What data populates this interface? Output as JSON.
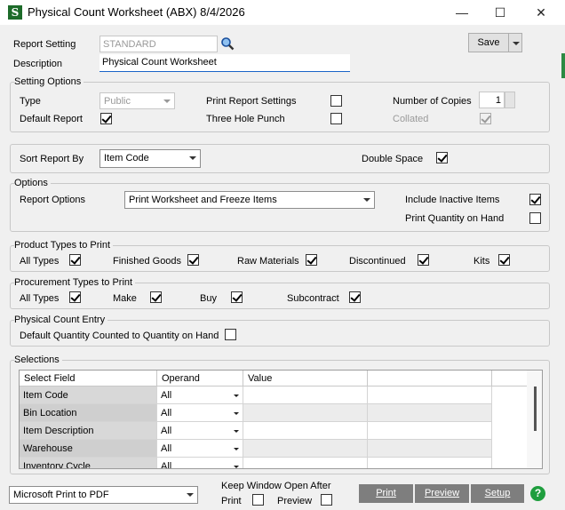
{
  "window": {
    "title": "Physical Count Worksheet (ABX) 8/4/2026",
    "minimize": "—",
    "maximize": "☐",
    "close": "✕",
    "app_icon": "S"
  },
  "header": {
    "report_setting_label": "Report Setting",
    "report_setting_value": "STANDARD",
    "description_label": "Description",
    "description_value": "Physical Count Worksheet",
    "save_label": "Save"
  },
  "setting_options": {
    "title": "Setting Options",
    "type_label": "Type",
    "type_value": "Public",
    "default_report_label": "Default Report",
    "default_report_checked": true,
    "print_report_settings_label": "Print Report Settings",
    "print_report_settings_checked": false,
    "three_hole_punch_label": "Three Hole Punch",
    "three_hole_punch_checked": false,
    "number_of_copies_label": "Number of Copies",
    "number_of_copies_value": "1",
    "collated_label": "Collated",
    "collated_checked": true
  },
  "sort": {
    "sort_report_by_label": "Sort Report By",
    "sort_report_by_value": "Item Code",
    "double_space_label": "Double Space",
    "double_space_checked": true
  },
  "options": {
    "title": "Options",
    "report_options_label": "Report Options",
    "report_options_value": "Print Worksheet and Freeze Items",
    "include_inactive_label": "Include Inactive Items",
    "include_inactive_checked": true,
    "print_qty_label": "Print Quantity on Hand",
    "print_qty_checked": false
  },
  "product_types": {
    "title": "Product Types to Print",
    "items": [
      {
        "label": "All Types",
        "checked": true
      },
      {
        "label": "Finished Goods",
        "checked": true
      },
      {
        "label": "Raw Materials",
        "checked": true
      },
      {
        "label": "Discontinued",
        "checked": true
      },
      {
        "label": "Kits",
        "checked": true
      }
    ]
  },
  "procurement_types": {
    "title": "Procurement Types to Print",
    "items": [
      {
        "label": "All Types",
        "checked": true
      },
      {
        "label": "Make",
        "checked": true
      },
      {
        "label": "Buy",
        "checked": true
      },
      {
        "label": "Subcontract",
        "checked": true
      }
    ]
  },
  "physical_count_entry": {
    "title": "Physical Count Entry",
    "default_qty_label": "Default Quantity Counted to Quantity on Hand",
    "default_qty_checked": false
  },
  "selections": {
    "title": "Selections",
    "columns": [
      "Select Field",
      "Operand",
      "Value"
    ],
    "rows": [
      {
        "field": "Item Code",
        "operand": "All",
        "value": ""
      },
      {
        "field": "Bin Location",
        "operand": "All",
        "value": ""
      },
      {
        "field": "Item Description",
        "operand": "All",
        "value": ""
      },
      {
        "field": "Warehouse",
        "operand": "All",
        "value": ""
      },
      {
        "field": "Inventory Cycle",
        "operand": "All",
        "value": ""
      }
    ]
  },
  "footer": {
    "printer_value": "Microsoft Print to PDF",
    "keep_window_label": "Keep Window Open After",
    "print_label": "Print",
    "print_checked": false,
    "preview_label": "Preview",
    "preview_checked": false,
    "print_button": "Print",
    "preview_button": "Preview",
    "setup_button": "Setup",
    "help_label": "?"
  },
  "colors": {
    "accent": "#1a64c8",
    "brand": "#1d6b2a",
    "button_dark": "#7e7e7e"
  }
}
